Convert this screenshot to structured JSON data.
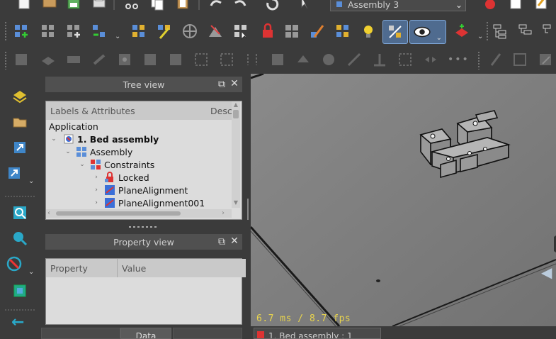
{
  "toolbar": {
    "document_select": "Assembly 3"
  },
  "tree_view": {
    "title": "Tree view",
    "columns": [
      "Labels & Attributes",
      "Description"
    ],
    "col_desc_short": "Desc",
    "application_label": "Application",
    "items": [
      {
        "label": "1. Bed assembly"
      },
      {
        "label": "Assembly"
      },
      {
        "label": "Constraints"
      },
      {
        "label": "Locked"
      },
      {
        "label": "PlaneAlignment"
      },
      {
        "label": "PlaneAlignment001"
      }
    ]
  },
  "property_view": {
    "title": "Property view",
    "columns": [
      "Property",
      "Value"
    ]
  },
  "viewport": {
    "fps_text": "6.7 ms / 8.7 fps"
  },
  "bottom_tabs": {
    "left_tab": "Data",
    "doc_tab": "1. Bed assembly : 1"
  },
  "colors": {
    "background": "#3b3b3b",
    "viewport": "#7d7d7d",
    "panel": "#dcdcdc",
    "accent": "#3a7ee0",
    "fps": "#e8d44d"
  }
}
